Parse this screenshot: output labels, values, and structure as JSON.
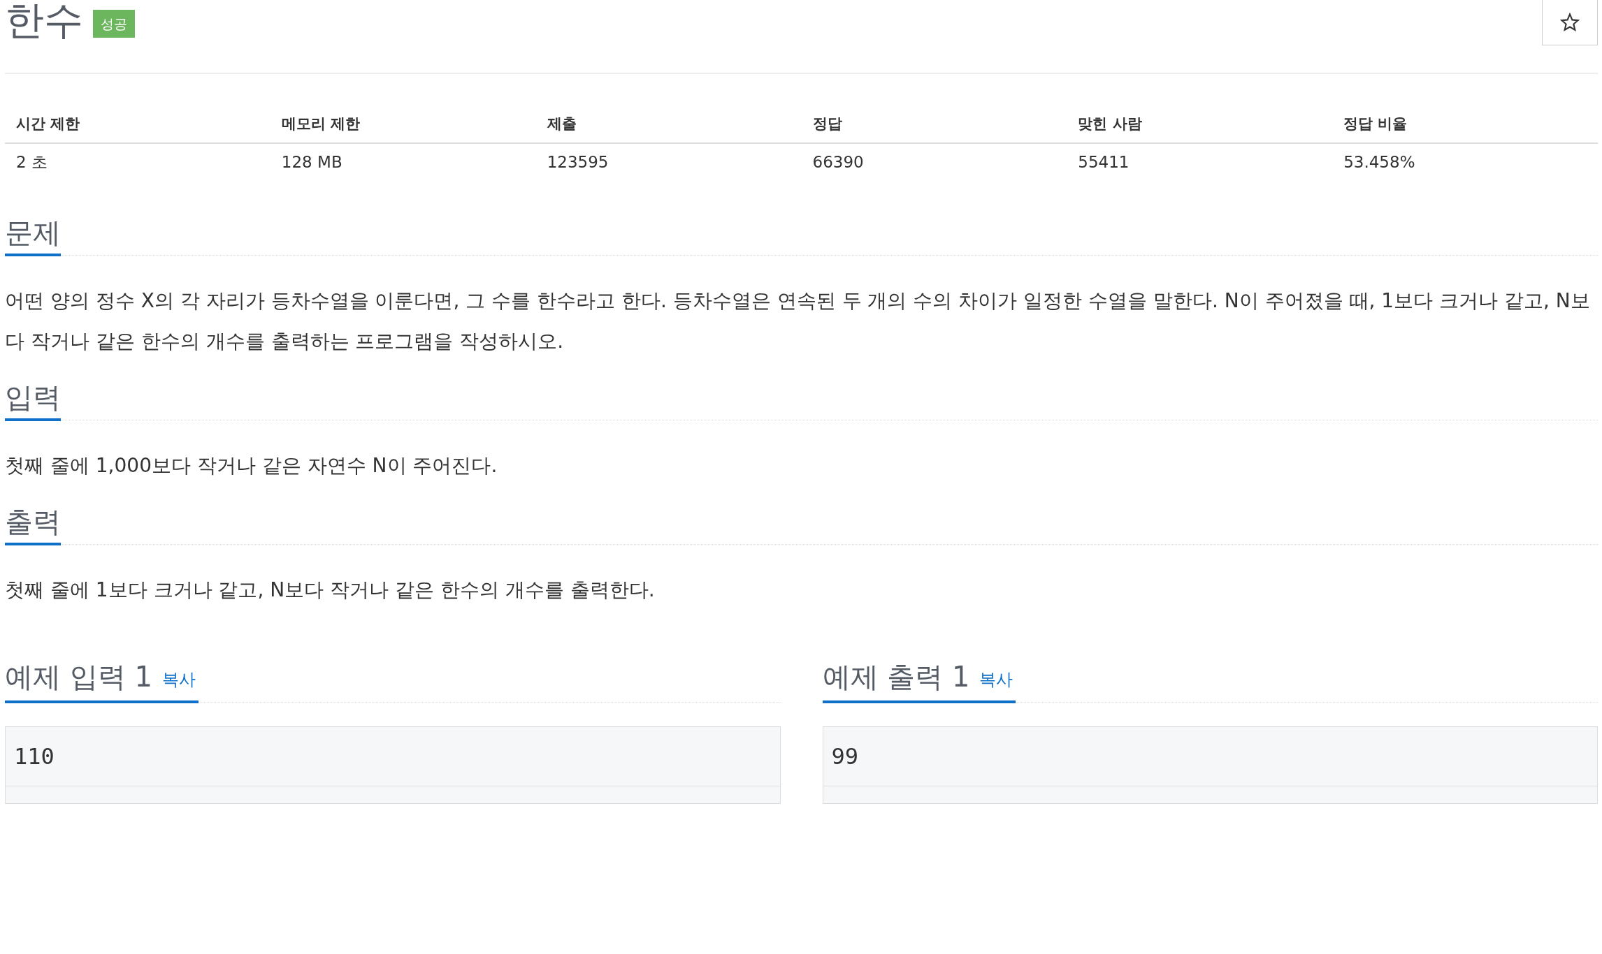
{
  "problem": {
    "title": "한수",
    "badge": "성공"
  },
  "info_table": {
    "columns": [
      "시간 제한",
      "메모리 제한",
      "제출",
      "정답",
      "맞힌 사람",
      "정답 비율"
    ],
    "row": [
      "2 초",
      "128 MB",
      "123595",
      "66390",
      "55411",
      "53.458%"
    ]
  },
  "sections": [
    {
      "heading": "문제",
      "body": "어떤 양의 정수 X의 각 자리가 등차수열을 이룬다면, 그 수를 한수라고 한다. 등차수열은 연속된 두 개의 수의 차이가 일정한 수열을 말한다. N이 주어졌을 때, 1보다 크거나 같고, N보다 작거나 같은 한수의 개수를 출력하는 프로그램을 작성하시오."
    },
    {
      "heading": "입력",
      "body": "첫째 줄에 1,000보다 작거나 같은 자연수 N이 주어진다."
    },
    {
      "heading": "출력",
      "body": "첫째 줄에 1보다 크거나 같고, N보다 작거나 같은 한수의 개수를 출력한다."
    }
  ],
  "samples": [
    {
      "heading": "예제 입력 1",
      "copy": "복사",
      "content": "110"
    },
    {
      "heading": "예제 출력 1",
      "copy": "복사",
      "content": "99"
    }
  ]
}
